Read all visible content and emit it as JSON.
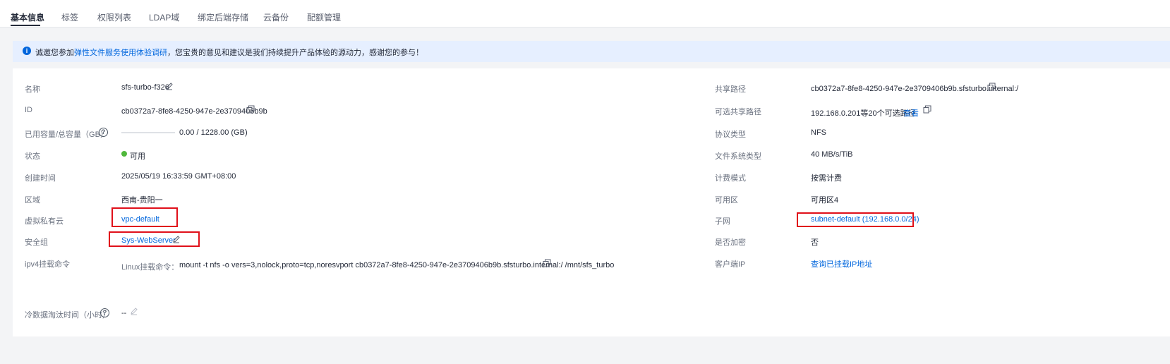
{
  "tabs": [
    "基本信息",
    "标签",
    "权限列表",
    "LDAP域",
    "绑定后端存储",
    "云备份",
    "配额管理"
  ],
  "notice": {
    "icon": "info-icon",
    "before": "诚邀您参加",
    "link": "弹性文件服务使用体验调研",
    "after": "，您宝贵的意见和建议是我们持续提升产品体验的源动力，感谢您的参与！"
  },
  "left": {
    "name_label": "名称",
    "name_value": "sfs-turbo-f326",
    "id_label": "ID",
    "id_value": "cb0372a7-8fe8-4250-947e-2e3709406b9b",
    "capacity_label": "已用容量/总容量（GB）",
    "capacity_value": "0.00 / 1228.00 (GB)",
    "capacity_used_fraction": 0.0,
    "status_label": "状态",
    "status_value": "可用",
    "created_label": "创建时间",
    "created_value": "2025/05/19 16:33:59 GMT+08:00",
    "region_label": "区域",
    "region_value": "西南-贵阳一",
    "vpc_label": "虚拟私有云",
    "vpc_value": "vpc-default",
    "sg_label": "安全组",
    "sg_value": "Sys-WebServer",
    "ipv4_label": "ipv4挂载命令",
    "linux_label": "Linux挂载命令：",
    "mount_command": "mount -t nfs -o vers=3,nolock,proto=tcp,noresvport cb0372a7-8fe8-4250-947e-2e3709406b9b.sfsturbo.internal:/ /mnt/sfs_turbo",
    "cold_label": "冷数据淘汰时间（小时）",
    "cold_value": "--"
  },
  "right": {
    "share_path_label": "共享路径",
    "share_path_value": "cb0372a7-8fe8-4250-947e-2e3709406b9b.sfsturbo.internal:/",
    "alt_path_label": "可选共享路径",
    "alt_path_value": "192.168.0.201等20个可选路径",
    "alt_path_link": "查看",
    "protocol_label": "协议类型",
    "protocol_value": "NFS",
    "fs_type_label": "文件系统类型",
    "fs_type_value": "40 MB/s/TiB",
    "billing_label": "计费模式",
    "billing_value": "按需计费",
    "az_label": "可用区",
    "az_value": "可用区4",
    "subnet_label": "子网",
    "subnet_value": "subnet-default (192.168.0.0/24)",
    "encrypt_label": "是否加密",
    "encrypt_value": "否",
    "client_ip_label": "客户端IP",
    "client_ip_value": "查询已挂载IP地址"
  },
  "colors": {
    "accent": "#0066dd",
    "highlight_box": "#e0101a",
    "status_ok": "#50b83c"
  }
}
